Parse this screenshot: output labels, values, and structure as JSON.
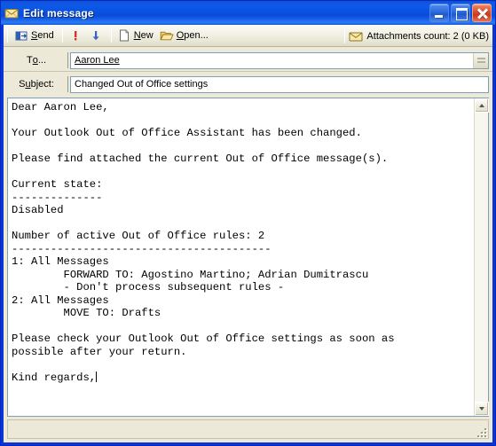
{
  "window": {
    "title": "Edit message",
    "icon": "envelope-icon",
    "caption_buttons": {
      "minimize": "Minimize",
      "maximize": "Maximize",
      "close": "Close"
    }
  },
  "toolbar": {
    "send_label": "Send",
    "high_priority_label": "High importance",
    "low_priority_label": "Low importance",
    "new_label": "New",
    "open_label": "Open...",
    "attachments_label": "Attachments count: 2  (0 KB)",
    "attachments_icon": "envelope-icon"
  },
  "headers": {
    "to_label": "To...",
    "to_value": "Aaron Lee",
    "to_placeholder": "",
    "subject_label": "Subject:",
    "subject_value": "Changed Out of Office settings",
    "subject_placeholder": ""
  },
  "message": {
    "body": "Dear Aaron Lee,\n\nYour Outlook Out of Office Assistant has been changed.\n\nPlease find attached the current Out of Office message(s).\n\nCurrent state:\n--------------\nDisabled\n\nNumber of active Out of Office rules: 2\n----------------------------------------\n1: All Messages\n        FORWARD TO: Agostino Martino; Adrian Dumitrascu\n        - Don't process subsequent rules -\n2: All Messages\n        MOVE TO: Drafts\n\nPlease check your Outlook Out of Office settings as soon as\npossible after your return.\n\nKind regards,"
  },
  "scrollbar": {
    "up_label": "Scroll up",
    "down_label": "Scroll down"
  },
  "statusbar": {
    "text": ""
  },
  "colors": {
    "titlebar_blue": "#0b52e0",
    "window_border": "#0b34d6",
    "client_bg": "#ece9d8",
    "close_red": "#d9452a",
    "field_border": "#7f9db9"
  }
}
